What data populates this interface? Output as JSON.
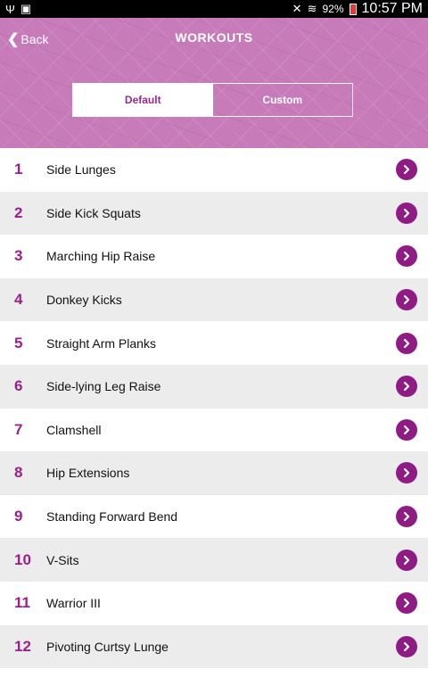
{
  "status_bar": {
    "battery": "92%",
    "time": "10:57 PM"
  },
  "header": {
    "back_label": "Back",
    "title": "WORKOUTS"
  },
  "tabs": [
    {
      "label": "Default",
      "active": true
    },
    {
      "label": "Custom",
      "active": false
    }
  ],
  "workouts": [
    {
      "num": "1",
      "name": "Side Lunges"
    },
    {
      "num": "2",
      "name": "Side Kick Squats"
    },
    {
      "num": "3",
      "name": "Marching Hip Raise"
    },
    {
      "num": "4",
      "name": "Donkey Kicks"
    },
    {
      "num": "5",
      "name": "Straight Arm Planks"
    },
    {
      "num": "6",
      "name": "Side-lying Leg Raise"
    },
    {
      "num": "7",
      "name": "Clamshell"
    },
    {
      "num": "8",
      "name": "Hip Extensions"
    },
    {
      "num": "9",
      "name": "Standing Forward Bend"
    },
    {
      "num": "10",
      "name": "V-Sits"
    },
    {
      "num": "11",
      "name": "Warrior III"
    },
    {
      "num": "12",
      "name": "Pivoting Curtsy Lunge"
    }
  ],
  "colors": {
    "accent": "#8e1c84",
    "header_bg": "#c77cb9",
    "number": "#9b1f8a"
  },
  "icons": {
    "row_action": "chevron-right-circle-icon",
    "back": "chevron-left-icon"
  }
}
